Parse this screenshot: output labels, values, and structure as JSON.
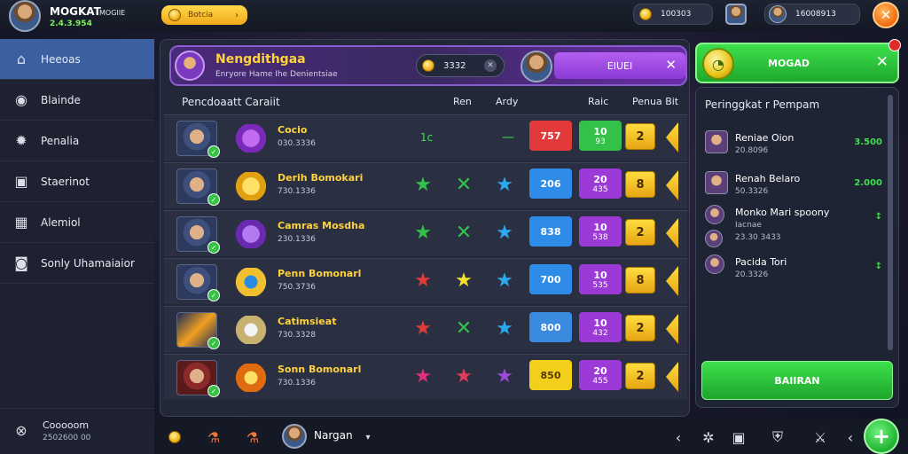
{
  "player": {
    "name": "MOGKAT",
    "tag": "MOGIIE",
    "coins": "2.4.3.954"
  },
  "top": {
    "yellow_pill": "Botcia",
    "coins_balance": "100303",
    "second_balance": "16008913"
  },
  "sidebar": {
    "items": [
      {
        "label": "Heeoas",
        "icon": "home-icon"
      },
      {
        "label": "Blainde",
        "icon": "globe-icon"
      },
      {
        "label": "Penalia",
        "icon": "gear-icon"
      },
      {
        "label": "Staerinot",
        "icon": "monitor-icon"
      },
      {
        "label": "Alemiol",
        "icon": "grid-icon"
      },
      {
        "label": "Sonly Uhamaiaior",
        "icon": "camera-icon"
      }
    ],
    "footer": {
      "label": "Cooooom",
      "sub": "2502600 00"
    }
  },
  "mode": {
    "title": "Nengdithgaa",
    "subtitle": "Enryore Hame Ihe Denientsiae",
    "score": "3332",
    "button": "EIUEI"
  },
  "table": {
    "headers": [
      "Pencdoaatt Caraiit",
      "Ren",
      "Ardy",
      "Raic",
      "Penua Bit"
    ],
    "rows": [
      {
        "name": "Cocio",
        "code": "030.3336",
        "c1": "1c",
        "c2": "—",
        "box1": "757",
        "box2_top": "10",
        "box2_bottom": "93",
        "lvl": "2"
      },
      {
        "name": "Derih Bomokari",
        "code": "730.1336",
        "c1": "★",
        "c2": "✕",
        "c3": "★",
        "box1": "206",
        "box2_top": "20",
        "box2_bottom": "435",
        "lvl": "8"
      },
      {
        "name": "Camras Mosdha",
        "code": "230.1336",
        "c1": "★",
        "c2": "✕",
        "c3": "★",
        "box1": "838",
        "box2_top": "10",
        "box2_bottom": "538",
        "lvl": "2"
      },
      {
        "name": "Penn Bomonarl",
        "code": "750.3736",
        "c1": "★",
        "c2": "★",
        "c3": "★",
        "box1": "700",
        "box2_top": "10",
        "box2_bottom": "535",
        "lvl": "8"
      },
      {
        "name": "Catimsieat",
        "code": "730.3328",
        "c1": "★",
        "c2": "✕",
        "c3": "★",
        "box1": "800",
        "box2_top": "10",
        "box2_bottom": "432",
        "lvl": "2"
      },
      {
        "name": "Sonn Bomonarl",
        "code": "730.1336",
        "c1": "★",
        "c2": "★",
        "c3": "★",
        "box1": "850",
        "box2_top": "20",
        "box2_bottom": "455",
        "lvl": "2"
      }
    ]
  },
  "play": {
    "label": "MOGAD"
  },
  "ranking": {
    "title": "Peringgkat r Pempam",
    "items": [
      {
        "name": "Reniae Oion",
        "code": "20.8096",
        "val": "3.500"
      },
      {
        "name": "Renah Belaro",
        "code": "50.3326",
        "val": "2.000"
      },
      {
        "name": "Monko Mari spoony",
        "code": "Iacnae",
        "val": "↕"
      },
      {
        "name": "",
        "code": "23.30 3433",
        "val": ""
      },
      {
        "name": "Pacida Tori",
        "code": "20.3326",
        "val": "↕"
      }
    ],
    "button": "BAIIRAN"
  },
  "bottom": {
    "name": "Nargan"
  },
  "colors": {
    "accent_green": "#3de04c",
    "accent_yellow": "#ffd33d",
    "accent_purple": "#8c3ad6"
  }
}
